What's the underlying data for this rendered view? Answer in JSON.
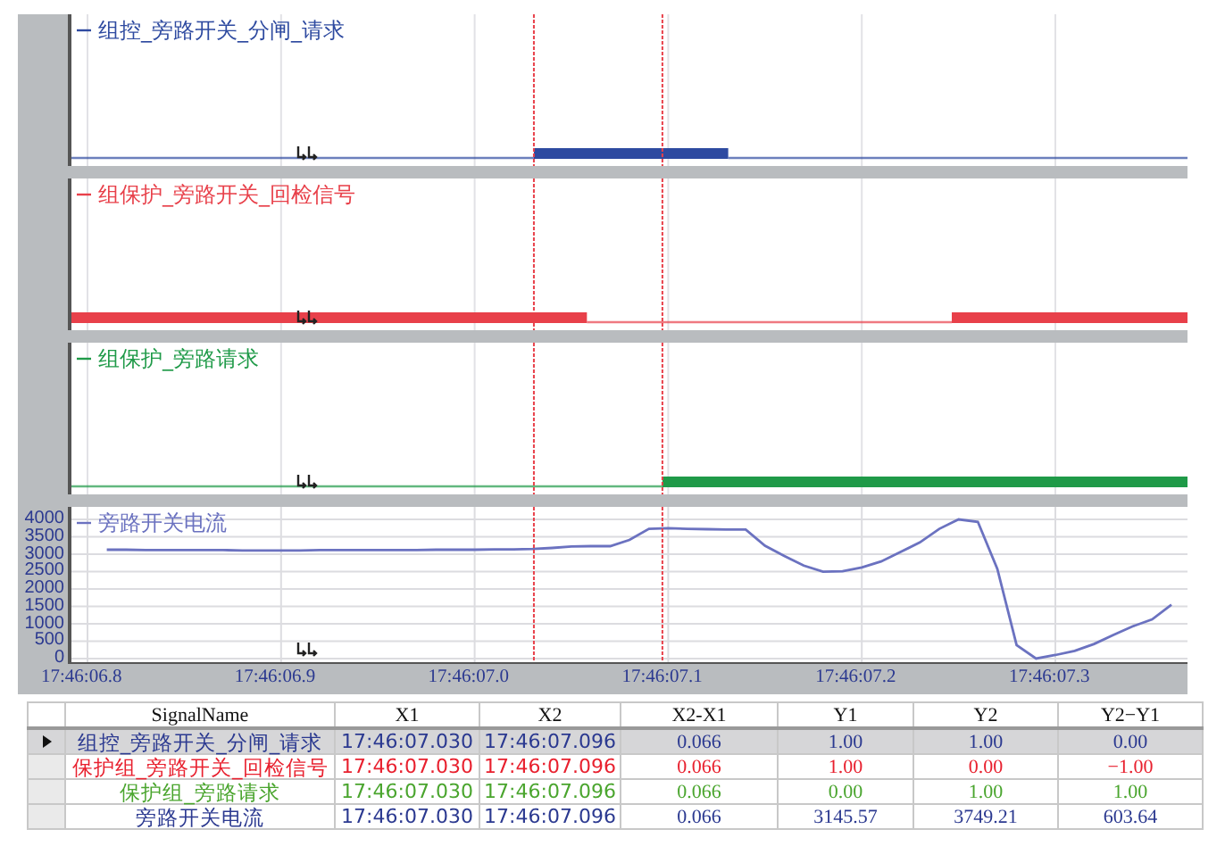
{
  "panels": [
    {
      "kind": "digital",
      "label": "组控_旁路开关_分闸_请求",
      "color": "#2e4aa0"
    },
    {
      "kind": "digital",
      "label": "组保护_旁路开关_回检信号",
      "color": "#e8404a"
    },
    {
      "kind": "digital",
      "label": "组保护_旁路请求",
      "color": "#1f9a48"
    },
    {
      "kind": "analog",
      "chart_data": {
        "type": "line",
        "grid": true,
        "ylim": [
          0,
          4000
        ],
        "categories": [
          "17:46:06.8",
          null,
          null,
          null,
          null,
          null,
          null,
          null,
          null,
          null,
          "17:46:06.9",
          null,
          null,
          null,
          null,
          null,
          null,
          null,
          null,
          null,
          "17:46:07.0",
          null,
          null,
          null,
          null,
          null,
          null,
          null,
          null,
          null,
          "17:46:07.1",
          null,
          null,
          null,
          null,
          null,
          null,
          null,
          null,
          null,
          "17:46:07.2",
          null,
          null,
          null,
          null,
          null,
          null,
          null,
          null,
          null,
          "17:46:07.3",
          null,
          null,
          null,
          null,
          null,
          null
        ],
        "yticks": [
          0,
          500,
          1000,
          1500,
          2000,
          2500,
          3000,
          3500,
          4000
        ],
        "series": [
          {
            "name": "旁路开关电流",
            "color": "#6b72c0",
            "values": [
              null,
              3130,
              3130,
              3120,
              3120,
              3120,
              3120,
              3120,
              3110,
              3110,
              3110,
              3110,
              3120,
              3120,
              3120,
              3120,
              3120,
              3120,
              3130,
              3130,
              3130,
              3140,
              3140,
              3150,
              3180,
              3220,
              3230,
              3230,
              3410,
              3730,
              3750,
              3730,
              3720,
              3710,
              3710,
              3240,
              2950,
              2670,
              2500,
              2510,
              2620,
              2790,
              3060,
              3340,
              3730,
              4000,
              3930,
              2580,
              390,
              0,
              100,
              220,
              420,
              680,
              930,
              1130,
              1550
            ]
          }
        ]
      }
    }
  ],
  "table": {
    "columns": [
      "SignalName",
      "X1",
      "X2",
      "X2-X1",
      "Y1",
      "Y2",
      "Y2−Y1"
    ],
    "rows": [
      {
        "selected": true,
        "color": "#2b3990",
        "cells": [
          "组控_旁路开关_分闸_请求",
          "17:46:07.030",
          "17:46:07.096",
          "0.066",
          "1.00",
          "1.00",
          "0.00"
        ]
      },
      {
        "selected": false,
        "color": "#e8202e",
        "cells": [
          "保护组_旁路开关_回检信号",
          "17:46:07.030",
          "17:46:07.096",
          "0.066",
          "1.00",
          "0.00",
          "−1.00"
        ]
      },
      {
        "selected": false,
        "color": "#4aa52e",
        "cells": [
          "保护组_旁路请求",
          "17:46:07.030",
          "17:46:07.096",
          "0.066",
          "0.00",
          "1.00",
          "1.00"
        ]
      },
      {
        "selected": false,
        "color": "#2b3990",
        "cells": [
          "旁路开关电流",
          "17:46:07.030",
          "17:46:07.096",
          "0.066",
          "3145.57",
          "3749.21",
          "603.64"
        ]
      }
    ]
  }
}
